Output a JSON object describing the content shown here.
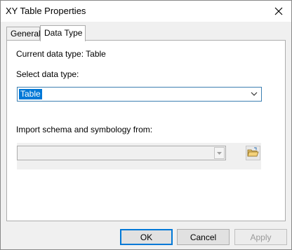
{
  "window": {
    "title": "XY Table Properties"
  },
  "tabs": [
    {
      "label": "General",
      "active": false
    },
    {
      "label": "Data Type",
      "active": true
    }
  ],
  "panel": {
    "current_type_text": "Current data type: Table",
    "select_label": "Select data type:",
    "selected_type": "Table",
    "import_label": "Import schema and symbology from:",
    "import_value": ""
  },
  "buttons": {
    "ok": "OK",
    "cancel": "Cancel",
    "apply": "Apply"
  },
  "icons": {
    "close": "close-icon",
    "dropdown": "chevron-down-icon",
    "folder": "folder-open-icon"
  },
  "colors": {
    "accent": "#0078d7",
    "selection": "#0078d7"
  }
}
